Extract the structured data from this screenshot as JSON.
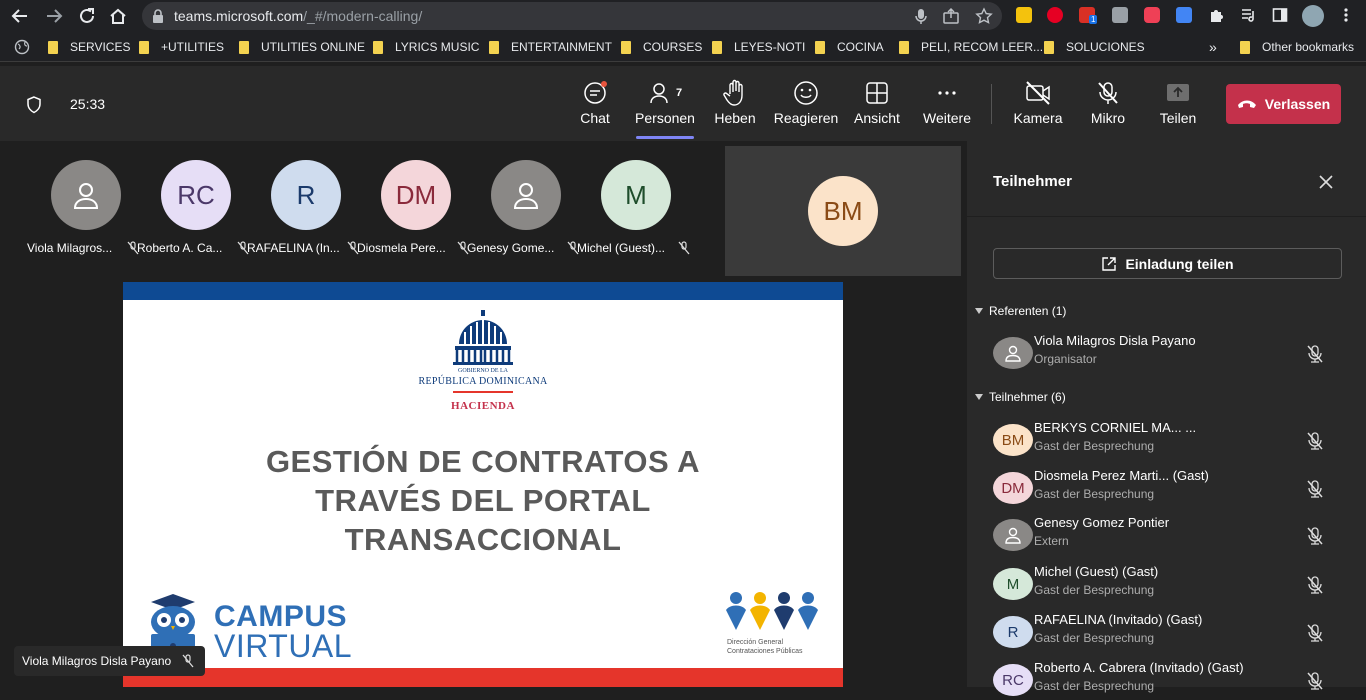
{
  "browser": {
    "url_host": "teams.microsoft.com",
    "url_path": "/_#/modern-calling/",
    "extension_badge": "1",
    "bookmarks": [
      {
        "label": "SERVICES"
      },
      {
        "label": "+UTILITIES"
      },
      {
        "label": "UTILITIES ONLINE"
      },
      {
        "label": "LYRICS MUSIC"
      },
      {
        "label": "ENTERTAINMENT"
      },
      {
        "label": "COURSES"
      },
      {
        "label": "LEYES-NOTI"
      },
      {
        "label": "COCINA"
      },
      {
        "label": "PELI, RECOM LEER..."
      },
      {
        "label": "SOLUCIONES"
      }
    ],
    "more_bookmarks": "»",
    "other_bookmarks": "Other bookmarks"
  },
  "meeting": {
    "timer": "25:33",
    "people_count": "7",
    "controls": {
      "chat": "Chat",
      "people": "Personen",
      "raise": "Heben",
      "react": "Reagieren",
      "view": "Ansicht",
      "more": "Weitere",
      "camera": "Kamera",
      "mic": "Mikro",
      "share": "Teilen",
      "leave": "Verlassen"
    },
    "accent": "#c4314b",
    "active_underline": "#7f85f5"
  },
  "gallery": [
    {
      "name": "Viola Milagros...",
      "initials": "",
      "bg": "#8a8886",
      "color": "#ffffff"
    },
    {
      "name": "Roberto A. Ca...",
      "initials": "RC",
      "bg": "#e6def6",
      "color": "#4b3869"
    },
    {
      "name": "RAFAELINA (In...",
      "initials": "R",
      "bg": "#cfdcee",
      "color": "#1b3a6b"
    },
    {
      "name": "Diosmela Pere...",
      "initials": "DM",
      "bg": "#f4d6da",
      "color": "#8a2a3b"
    },
    {
      "name": "Genesy Gome...",
      "initials": "",
      "bg": "#8a8886",
      "color": "#ffffff"
    },
    {
      "name": "Michel (Guest)...",
      "initials": "M",
      "bg": "#d5e8d9",
      "color": "#1e4d2b"
    }
  ],
  "speaker": {
    "initials": "BM",
    "bg": "#fbe3c9",
    "color": "#8a4b16"
  },
  "slide": {
    "seal_line1": "GOBIERNO DE LA",
    "seal_line2": "REPÚBLICA DOMINICANA",
    "seal_line3": "HACIENDA",
    "title_lines": [
      "GESTIÓN DE CONTRATOS A",
      "TRAVÉS DEL PORTAL",
      "TRANSACCIONAL"
    ],
    "campus_line1": "CAMPUS",
    "campus_line2": "VIRTUAL",
    "dgcp_line1": "Dirección General",
    "dgcp_line2": "Contrataciones Públicas"
  },
  "presenter_tag": "Viola Milagros Disla Payano",
  "participants_pane": {
    "title": "Teilnehmer",
    "invite_label": "Einladung teilen",
    "presenters_header": "Referenten (1)",
    "attendees_header": "Teilnehmer (6)",
    "presenters": [
      {
        "name": "Viola Milagros Disla Payano",
        "role": "Organisator",
        "initials": "",
        "bg": "#8a8886",
        "color": "#ffffff"
      }
    ],
    "attendees": [
      {
        "name": "BERKYS CORNIEL MA... ...",
        "role": "Gast der Besprechung",
        "initials": "BM",
        "bg": "#fbe3c9",
        "color": "#8a4b16"
      },
      {
        "name": "Diosmela Perez Marti... (Gast)",
        "role": "Gast der Besprechung",
        "initials": "DM",
        "bg": "#f4d6da",
        "color": "#8a2a3b"
      },
      {
        "name": "Genesy Gomez Pontier",
        "role": "Extern",
        "initials": "",
        "bg": "#8a8886",
        "color": "#ffffff"
      },
      {
        "name": "Michel (Guest) (Gast)",
        "role": "Gast der Besprechung",
        "initials": "M",
        "bg": "#d5e8d9",
        "color": "#1e4d2b"
      },
      {
        "name": "RAFAELINA (Invitado) (Gast)",
        "role": "Gast der Besprechung",
        "initials": "R",
        "bg": "#cfdcee",
        "color": "#1b3a6b"
      },
      {
        "name": "Roberto A. Cabrera (Invitado) (Gast)",
        "role": "Gast der Besprechung",
        "initials": "RC",
        "bg": "#e6def6",
        "color": "#4b3869"
      }
    ]
  }
}
